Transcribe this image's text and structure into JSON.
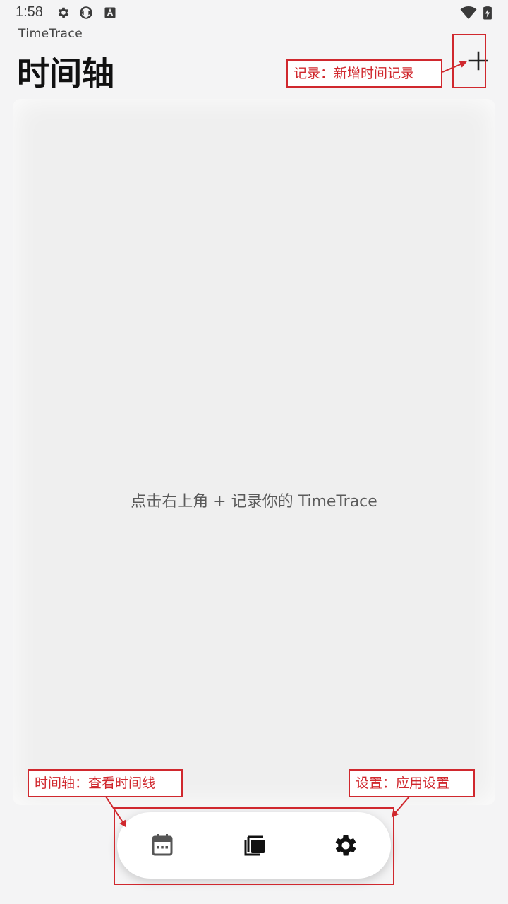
{
  "status_bar": {
    "time": "1:58",
    "icons": [
      "gear-icon",
      "sync-icon",
      "font-icon",
      "wifi-icon",
      "battery-charging-icon"
    ]
  },
  "header": {
    "app_name": "TimeTrace",
    "title": "时间轴",
    "add_label": "+"
  },
  "main": {
    "empty_hint": "点击右上角 + 记录你的 TimeTrace"
  },
  "bottom_nav": {
    "items": [
      {
        "name": "timeline",
        "icon": "calendar-icon"
      },
      {
        "name": "records",
        "icon": "copy-stack-icon"
      },
      {
        "name": "settings",
        "icon": "gear-icon"
      }
    ]
  },
  "annotations": {
    "add": "记录：新增时间记录",
    "timeline": "时间轴：查看时间线",
    "settings": "设置：应用设置"
  },
  "colors": {
    "annotation": "#d0282e",
    "background": "#f4f4f5",
    "nav_bg": "#ffffff"
  }
}
